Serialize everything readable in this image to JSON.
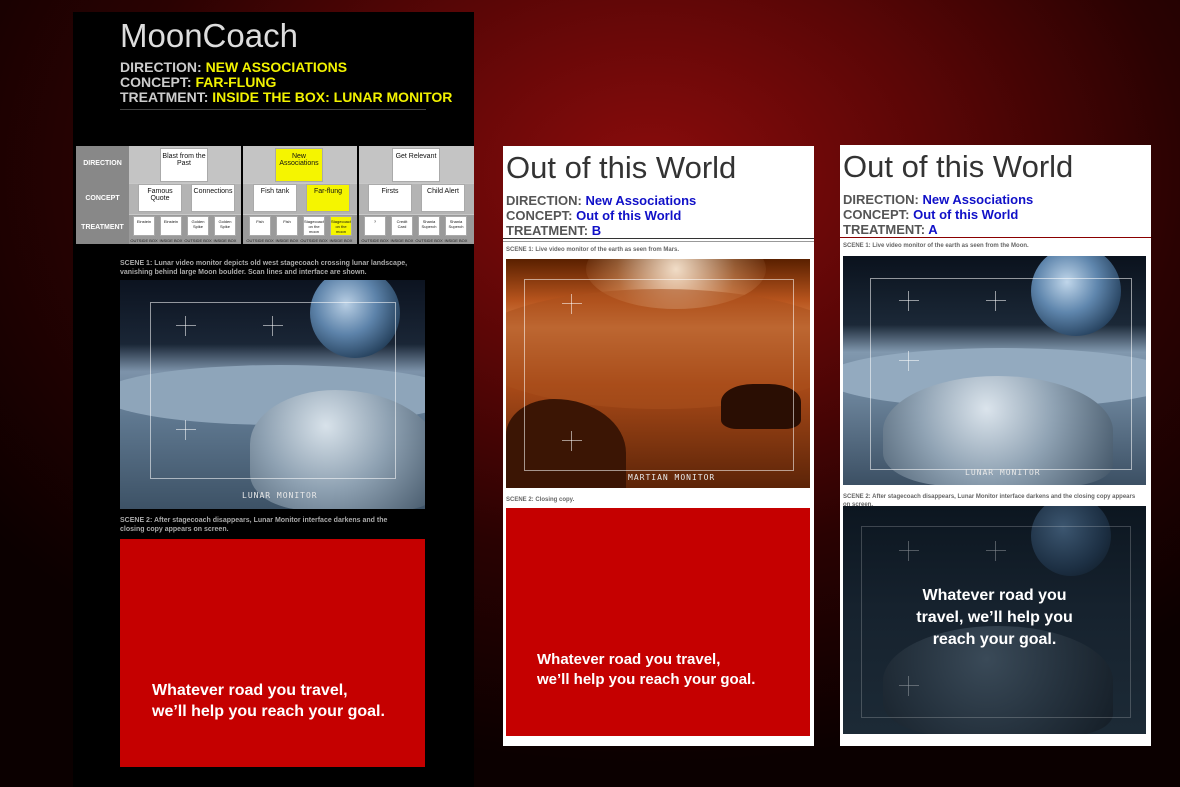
{
  "board1": {
    "title": "MoonCoach",
    "direction_label": "DIRECTION:",
    "direction_value": "NEW ASSOCIATIONS",
    "concept_label": "CONCEPT:",
    "concept_value": "FAR-FLUNG",
    "treatment_label": "TREATMENT:",
    "treatment_value": "INSIDE THE BOX: LUNAR MONITOR",
    "grid": {
      "row_labels": [
        "DIRECTION",
        "CONCEPT",
        "TREATMENT"
      ],
      "directions": [
        "Blast from the Past",
        "New Associations",
        "Get Relevant"
      ],
      "concepts": [
        "Famous Quote",
        "Connections",
        "Fish tank",
        "Far-flung",
        "Firsts",
        "Child Alert"
      ],
      "treatments": [
        "Einstein",
        "Einstein",
        "Golden Spike",
        "Golden Spike",
        "Fish",
        "Fish",
        "Stagecoach on the moon",
        "Stagecoach on the moon",
        "?",
        "Credit Card",
        "Shania Superch",
        "Shania Superch"
      ],
      "treatment_captions": [
        "OUTSIDE BOX",
        "INSIDE BOX",
        "OUTSIDE BOX",
        "INSIDE BOX",
        "OUTSIDE BOX",
        "INSIDE BOX",
        "OUTSIDE BOX",
        "INSIDE BOX",
        "OUTSIDE BOX",
        "INSIDE BOX",
        "OUTSIDE BOX",
        "INSIDE BOX"
      ]
    },
    "scene1": "SCENE 1: Lunar video monitor depicts old west stagecoach crossing lunar landscape, vanishing behind large Moon boulder. Scan lines and interface are shown.",
    "monitor_label": "LUNAR MONITOR",
    "scene2": "SCENE 2: After stagecoach disappears, Lunar Monitor interface darkens and the closing copy appears on screen.",
    "copy_line1": "Whatever road you travel,",
    "copy_line2": "we’ll help you reach your goal."
  },
  "board2": {
    "title": "Out of this World",
    "direction_label": "DIRECTION:",
    "direction_value": "New Associations",
    "concept_label": "CONCEPT:",
    "concept_value": "Out of this World",
    "treatment_label": "TREATMENT:",
    "treatment_value": "B",
    "scene1": "SCENE 1: Live video monitor of the earth as seen from Mars.",
    "monitor_label": "MARTIAN MONITOR",
    "scene2": "SCENE 2: Closing copy.",
    "copy_line1": "Whatever road you travel,",
    "copy_line2": "we’ll help you reach your goal."
  },
  "board3": {
    "title": "Out of this World",
    "direction_label": "DIRECTION:",
    "direction_value": "New Associations",
    "concept_label": "CONCEPT:",
    "concept_value": "Out of this World",
    "treatment_label": "TREATMENT:",
    "treatment_value": "A",
    "scene1": "SCENE 1:  Live video monitor of the earth as seen from the Moon.",
    "monitor_label": "LUNAR MONITOR",
    "scene2": "SCENE 2: After stagecoach disappears, Lunar Monitor interface darkens and the closing copy appears on screen.",
    "copy_line1": "Whatever road you",
    "copy_line2": "travel, we’ll help you",
    "copy_line3": "reach your goal."
  },
  "colors": {
    "board1_value": "#f2f200",
    "board23_value": "#1010c8",
    "highlight_cell": "#f5f500",
    "closing_red": "#c50000"
  }
}
